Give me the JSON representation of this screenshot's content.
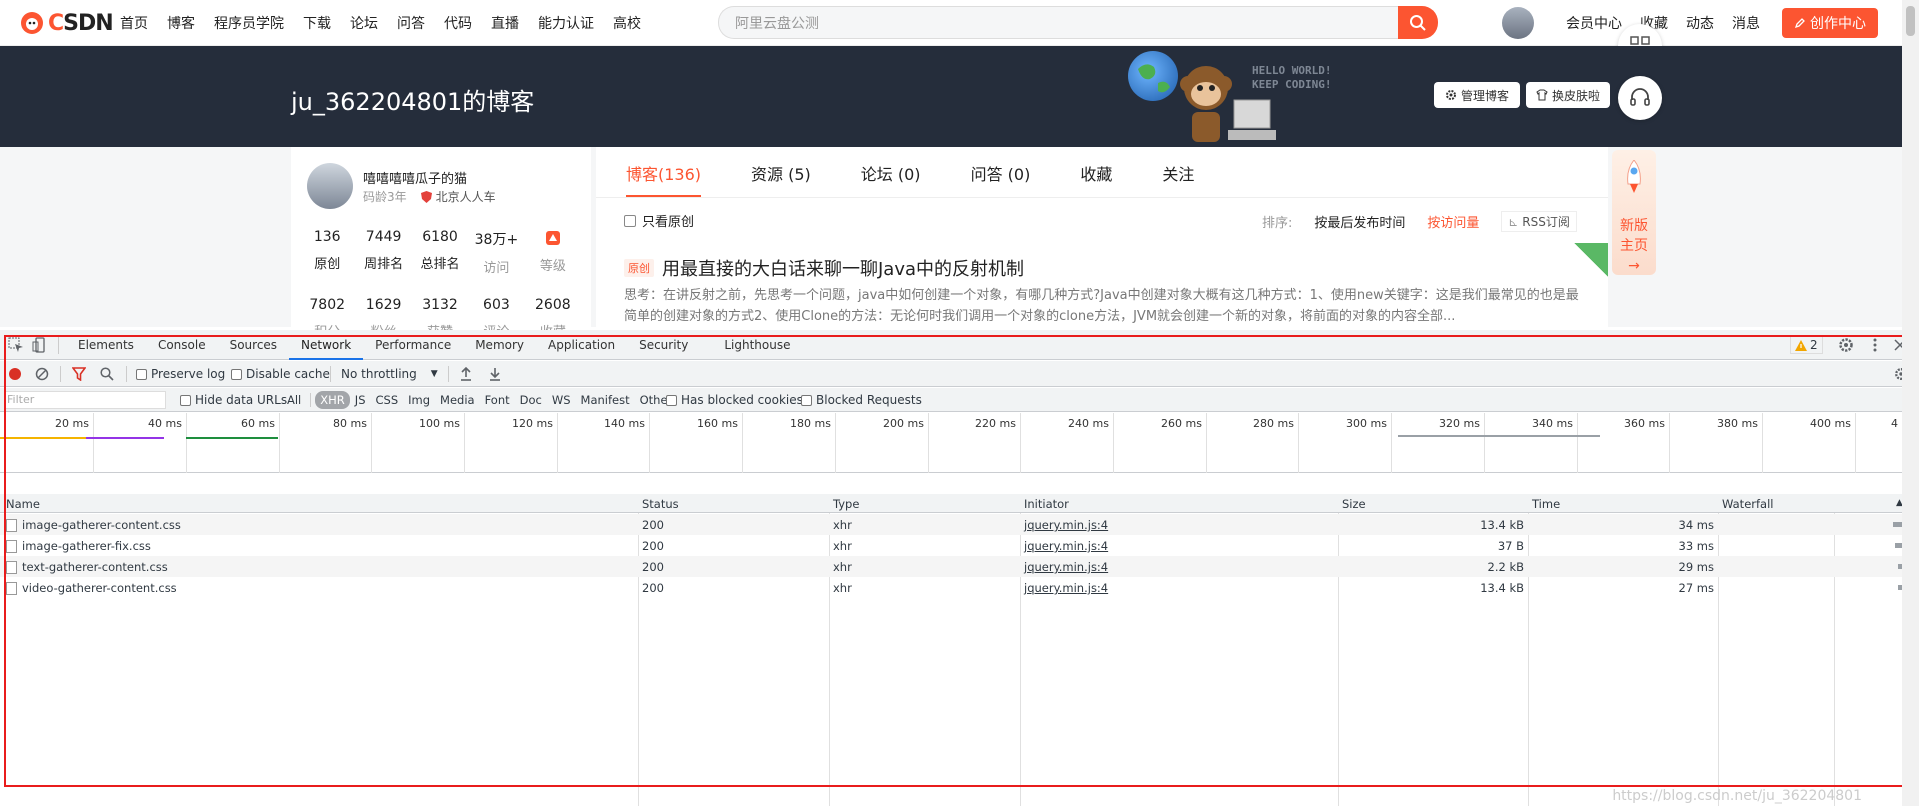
{
  "site": {
    "logo_text": "CSDN",
    "nav": [
      "首页",
      "博客",
      "程序员学院",
      "下载",
      "论坛",
      "问答",
      "代码",
      "直播",
      "能力认证",
      "高校"
    ],
    "search_placeholder": "阿里云盘公测",
    "top_links": [
      "会员中心",
      "收藏",
      "动态",
      "消息"
    ],
    "create_label": "创作中心"
  },
  "banner": {
    "blog_title": "ju_362204801的博客",
    "hello_line1": "HELLO WORLD!",
    "hello_line2": "KEEP CODING!",
    "manage_label": "管理博客",
    "skin_label": "换皮肤啦"
  },
  "profile": {
    "name": "嘻嘻嘻嘻瓜子的猫",
    "age": "码龄3年",
    "company": "北京人人车",
    "stats_row1": [
      {
        "value": "136",
        "label": "原创"
      },
      {
        "value": "7449",
        "label": "周排名"
      },
      {
        "value": "6180",
        "label": "总排名"
      },
      {
        "value": "38万+",
        "label": "访问"
      },
      {
        "value": "",
        "label": "等级"
      }
    ],
    "stats_row2": [
      {
        "value": "7802",
        "label": "积分"
      },
      {
        "value": "1629",
        "label": "粉丝"
      },
      {
        "value": "3132",
        "label": "获赞"
      },
      {
        "value": "603",
        "label": "评论"
      },
      {
        "value": "2608",
        "label": "收藏"
      }
    ]
  },
  "main": {
    "tabs": [
      "博客(136)",
      "资源 (5)",
      "论坛 (0)",
      "问答 (0)",
      "收藏",
      "关注"
    ],
    "only_original": "只看原创",
    "sort_label": "排序:",
    "sort_by_time": "按最后发布时间",
    "sort_by_views": "按访问量",
    "rss": "RSS订阅",
    "article": {
      "tag": "原创",
      "title": "用最直接的大白话来聊一聊Java中的反射机制",
      "desc": "思考：在讲反射之前，先思考一个问题，java中如何创建一个对象，有哪几种方式?Java中创建对象大概有这几种方式：1、使用new关键字：这是我们最常见的也是最简单的创建对象的方式2、使用Clone的方法：无论何时我们调用一个对象的clone方法，JVM就会创建一个新的对象，将前面的对象的内容全部..."
    }
  },
  "rocket": {
    "line1": "新版",
    "line2": "主页"
  },
  "devtools": {
    "tabs": [
      "Elements",
      "Console",
      "Sources",
      "Network",
      "Performance",
      "Memory",
      "Application",
      "Security",
      "Lighthouse"
    ],
    "active_tab": "Network",
    "warning_count": "2",
    "preserve_log": "Preserve log",
    "disable_cache": "Disable cache",
    "throttling": "No throttling",
    "filter_placeholder": "Filter",
    "hide_data_urls": "Hide data URLs",
    "types": [
      "All",
      "XHR",
      "JS",
      "CSS",
      "Img",
      "Media",
      "Font",
      "Doc",
      "WS",
      "Manifest",
      "Other"
    ],
    "active_type": "XHR",
    "blocked_cookies": "Has blocked cookies",
    "blocked_requests": "Blocked Requests",
    "timeline_ticks": [
      "20 ms",
      "40 ms",
      "60 ms",
      "80 ms",
      "100 ms",
      "120 ms",
      "140 ms",
      "160 ms",
      "180 ms",
      "200 ms",
      "220 ms",
      "240 ms",
      "260 ms",
      "280 ms",
      "300 ms",
      "320 ms",
      "340 ms",
      "360 ms",
      "380 ms",
      "400 ms",
      "4"
    ],
    "columns": [
      "Name",
      "Status",
      "Type",
      "Initiator",
      "Size",
      "Time",
      "Waterfall"
    ],
    "rows": [
      {
        "name": "image-gatherer-content.css",
        "status": "200",
        "type": "xhr",
        "initiator": "jquery.min.js:4",
        "size": "13.4 kB",
        "time": "34 ms"
      },
      {
        "name": "image-gatherer-fix.css",
        "status": "200",
        "type": "xhr",
        "initiator": "jquery.min.js:4",
        "size": "37 B",
        "time": "33 ms"
      },
      {
        "name": "text-gatherer-content.css",
        "status": "200",
        "type": "xhr",
        "initiator": "jquery.min.js:4",
        "size": "2.2 kB",
        "time": "29 ms"
      },
      {
        "name": "video-gatherer-content.css",
        "status": "200",
        "type": "xhr",
        "initiator": "jquery.min.js:4",
        "size": "13.4 kB",
        "time": "27 ms"
      }
    ]
  },
  "watermark": "https://blog.csdn.net/ju_362204801",
  "colors": {
    "brand": "#fc5531",
    "devtools_blue": "#1a73e8",
    "frame_red": "#e91c1c"
  }
}
